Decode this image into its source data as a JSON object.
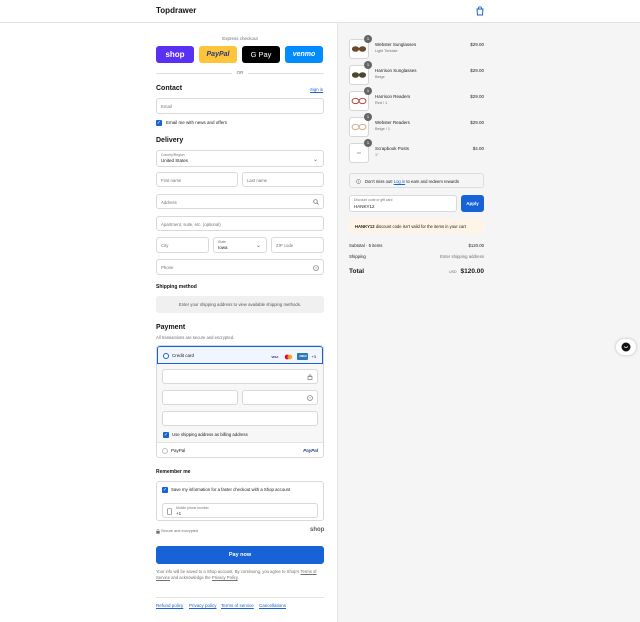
{
  "header": {
    "brand": "Topdrawer",
    "cart_icon": "shopping-bag-icon"
  },
  "express": {
    "label": "Express checkout",
    "buttons": [
      {
        "label": "shop",
        "color": "#5a31f4"
      },
      {
        "label": "PayPal",
        "color": "#ffc439"
      },
      {
        "label": "G Pay",
        "color": "#000000"
      },
      {
        "label": "venmo",
        "color": "#008cff"
      }
    ],
    "or": "OR"
  },
  "contact": {
    "title": "Contact",
    "signin": "Sign in",
    "email_placeholder": "Email",
    "news_label": "Email me with news and offers"
  },
  "delivery": {
    "title": "Delivery",
    "country_label": "Country/Region",
    "country_value": "United States",
    "first_name": "First name",
    "last_name": "Last name",
    "address": "Address",
    "apartment": "Apartment, suite, etc. (optional)",
    "city": "City",
    "state_label": "State",
    "state_value": "Iowa",
    "zip": "ZIP code",
    "phone": "Phone"
  },
  "shipping": {
    "title": "Shipping method",
    "message": "Enter your shipping address to view available shipping methods."
  },
  "payment": {
    "title": "Payment",
    "subtitle": "All transactions are secure and encrypted.",
    "credit_card": "Credit card",
    "cards": [
      "VISA",
      "MC",
      "AMEX"
    ],
    "more": "+3",
    "billing_label": "Use shipping address as billing address",
    "paypal": "PayPal",
    "paypal_logo": "PayPal"
  },
  "remember": {
    "title": "Remember me",
    "save_label": "Save my information for a faster checkout with a Shop account",
    "phone_label": "Mobile phone number",
    "phone_value": "+1",
    "secure": "Secure and encrypted",
    "shop": "shop"
  },
  "pay_button": "Pay now",
  "legal": {
    "line1": "Your info will be saved to a Shop account. By continuing, you agree to Shop's",
    "tos": "Terms of Service",
    "mid": "and acknowledge the",
    "privacy": "Privacy Policy",
    "end": "."
  },
  "footer": [
    "Refund policy",
    "Privacy policy",
    "Terms of service",
    "Cancellations"
  ],
  "summary": {
    "items": [
      {
        "name": "Webster Sunglasses",
        "variant": "Light Tortoise",
        "price": "$29.00",
        "qty": "1",
        "color": "#6b4a2a"
      },
      {
        "name": "Harrison Sunglasses",
        "variant": "Beige",
        "price": "$29.00",
        "qty": "1",
        "color": "#4a4a2a"
      },
      {
        "name": "Harrison Readers",
        "variant": "Red / 1",
        "price": "$29.00",
        "qty": "1",
        "color": "#b8322a"
      },
      {
        "name": "Webster Readers",
        "variant": "Beige / 1",
        "price": "$29.00",
        "qty": "1",
        "color": "#c9a77a"
      },
      {
        "name": "Scrapbook Posts",
        "variant": "1\"",
        "price": "$4.00",
        "qty": "1",
        "color": "#888888"
      }
    ],
    "rewards": {
      "text1": "Don't miss out!",
      "link": "Log in",
      "text2": "to earn and redeem rewards"
    },
    "discount_label": "Discount code or gift card",
    "discount_value": "HANKY12",
    "apply": "Apply",
    "error_code": "HANKY12",
    "error_text": "discount code isn't valid for the items in your cart",
    "subtotal_label": "Subtotal · 5 items",
    "subtotal_value": "$120.00",
    "shipping_label": "Shipping",
    "shipping_value": "Enter shipping address",
    "total_label": "Total",
    "currency": "USD",
    "total_value": "$120.00"
  }
}
